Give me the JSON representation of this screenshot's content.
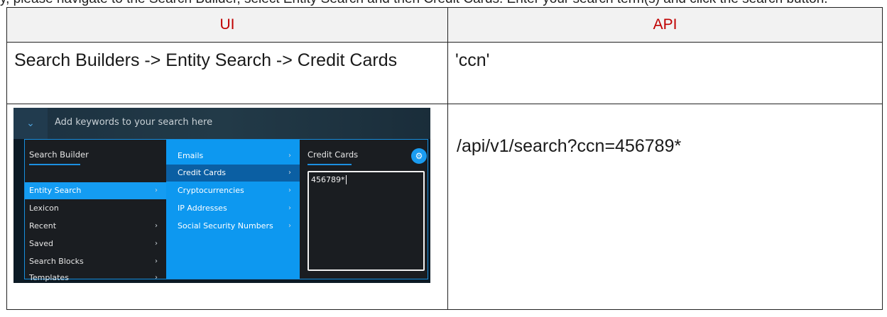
{
  "top_text": "y, please navigate to the Search Builder, select Entity Search and then Credit Cards. Enter your search term(s) and click the search button.",
  "table": {
    "headers": [
      "UI",
      "API"
    ],
    "row1": {
      "ui": "Search Builders -> Entity Search -> Credit Cards",
      "api": "'ccn'"
    },
    "row2": {
      "api": "/api/v1/search?ccn=456789*"
    }
  },
  "screenshot": {
    "search_placeholder": "Add keywords to your search here",
    "builder_title": "Search Builder",
    "builder_items": [
      {
        "label": "Entity Search",
        "has_chevron": true,
        "active": true
      },
      {
        "label": "Lexicon",
        "has_chevron": false,
        "active": false
      },
      {
        "label": "Recent",
        "has_chevron": true,
        "active": false
      },
      {
        "label": "Saved",
        "has_chevron": true,
        "active": false
      },
      {
        "label": "Search Blocks",
        "has_chevron": true,
        "active": false
      },
      {
        "label": "Templates",
        "has_chevron": true,
        "active": false
      }
    ],
    "entity_items": [
      {
        "label": "Emails",
        "active": false
      },
      {
        "label": "Credit Cards",
        "active": true
      },
      {
        "label": "Cryptocurrencies",
        "active": false
      },
      {
        "label": "IP Addresses",
        "active": false
      },
      {
        "label": "Social Security Numbers",
        "active": false
      }
    ],
    "panel_title": "Credit Cards",
    "input_value": "456789*",
    "chevron_glyph": "›",
    "colors": {
      "accent": "#149cf2",
      "entity_panel": "#0d98f0",
      "entity_selected": "#0b5fa3",
      "header_text": "#c00000"
    },
    "icons": {
      "dropdown": "chevron-down-icon",
      "settings": "gear-icon"
    }
  }
}
